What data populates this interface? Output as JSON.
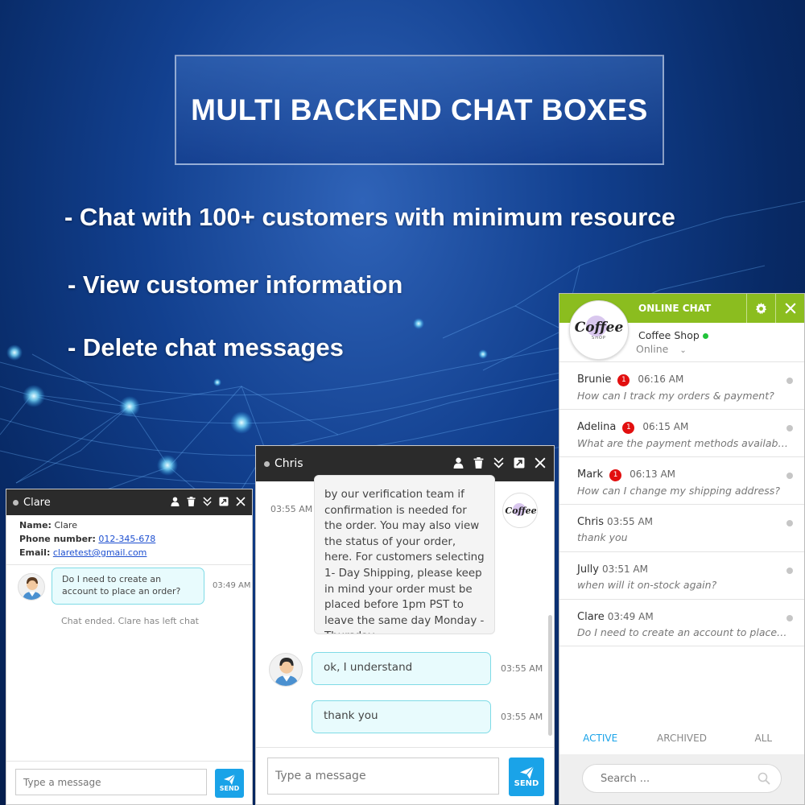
{
  "promo": {
    "title": "MULTI BACKEND CHAT BOXES",
    "bullets": [
      "- Chat with 100+ customers with minimum resource",
      "- View customer information",
      "- Delete chat messages"
    ]
  },
  "clare_window": {
    "name": "Clare",
    "info": {
      "name_label": "Name:",
      "name_value": "Clare",
      "phone_label": "Phone number:",
      "phone_value": "012-345-678",
      "email_label": "Email:",
      "email_value": "claretest@gmail.com"
    },
    "message": "Do I need to create an account to place an order?",
    "message_time": "03:49 AM",
    "system_note": "Chat ended. Clare has left chat",
    "input_placeholder": "Type a message",
    "send_label": "SEND"
  },
  "chris_window": {
    "name": "Chris",
    "long_message": "by our verification team if confirmation is needed for the order. You may also view the status of your order, here. For customers selecting 1- Day Shipping, please keep in mind your order must be placed before 1pm PST to leave the same day Monday - Thursday.",
    "long_message_time": "03:55 AM",
    "reply1": "ok, I understand",
    "reply1_time": "03:55 AM",
    "reply2": "thank you",
    "reply2_time": "03:55 AM",
    "input_placeholder": "Type a message",
    "send_label": "SEND"
  },
  "panel": {
    "title": "ONLINE CHAT",
    "logo_text": "Coffee",
    "logo_sub": "SHOP",
    "shop_name": "Coffee Shop",
    "status": "Online",
    "conversations": [
      {
        "name": "Brunie",
        "badge": "1",
        "time": "06:16 AM",
        "message": "How can I track my orders & payment?"
      },
      {
        "name": "Adelina",
        "badge": "1",
        "time": "06:15 AM",
        "message": "What are the payment methods available?"
      },
      {
        "name": "Mark",
        "badge": "1",
        "time": "06:13 AM",
        "message": "How can I change my shipping address?"
      },
      {
        "name": "Chris",
        "badge": "",
        "time": "03:55 AM",
        "message": "thank you"
      },
      {
        "name": "Jully",
        "badge": "",
        "time": "03:51 AM",
        "message": "when will it on-stock again?"
      },
      {
        "name": "Clare",
        "badge": "",
        "time": "03:49 AM",
        "message": "Do I need to create an account to place an order?"
      }
    ],
    "tabs": [
      "ACTIVE",
      "ARCHIVED",
      "ALL"
    ],
    "search_placeholder": "Search ..."
  },
  "colors": {
    "accent_green": "#8bbd1f",
    "accent_blue": "#1aa3e8",
    "badge_red": "#e20f0f",
    "online_green": "#21c33a"
  }
}
